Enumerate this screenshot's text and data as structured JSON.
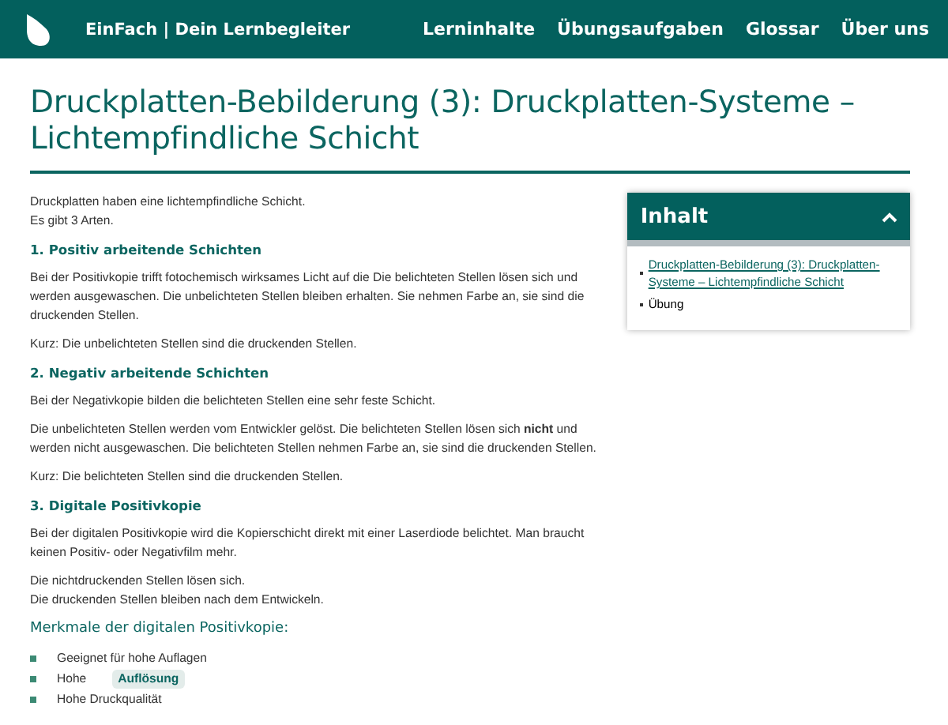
{
  "header": {
    "site_name": "EinFach | Dein Lernbegleiter",
    "nav": [
      {
        "label": "Lerninhalte"
      },
      {
        "label": "Übungsaufgaben"
      },
      {
        "label": "Glossar"
      },
      {
        "label": "Über uns"
      }
    ]
  },
  "title": "Druckplatten-Bebilderung (3): Druckplatten-Systeme – Lichtempfindliche Schicht",
  "content": [
    {
      "kind": "paragraph",
      "lines": [
        "Druckplatten haben eine lichtempfindliche Schicht.",
        "Es gibt 3 Arten."
      ]
    },
    {
      "kind": "heading",
      "text": "1. Positiv arbeitende Schichten"
    },
    {
      "kind": "paragraph",
      "lines": [
        "Bei der Positivkopie trifft fotochemisch wirksames Licht auf die Die belichteten Stellen lösen sich und werden ausgewaschen. Die unbelichteten Stellen bleiben erhalten. Sie nehmen Farbe an, sie sind die druckenden Stellen."
      ]
    },
    {
      "kind": "paragraph",
      "lines": [
        "Kurz: Die unbelichteten Stellen sind die druckenden Stellen."
      ]
    },
    {
      "kind": "heading",
      "text": "2. Negativ arbeitende Schichten"
    },
    {
      "kind": "paragraph",
      "lines": [
        "Bei der Negativkopie bilden die belichteten Stellen eine sehr feste Schicht."
      ]
    },
    {
      "kind": "paragraph",
      "lines": [
        "Die unbelichteten Stellen werden vom Entwickler gelöst. Die belichteten Stellen lösen sich **nicht** und werden nicht ausgewaschen. Die belichteten Stellen nehmen Farbe an, sie sind die druckenden Stellen."
      ]
    },
    {
      "kind": "paragraph",
      "lines": [
        "Kurz: Die belichteten Stellen sind die druckenden Stellen."
      ]
    },
    {
      "kind": "heading",
      "text": "3. Digitale Positivkopie"
    },
    {
      "kind": "paragraph",
      "lines": [
        "Bei der digitalen Positivkopie wird die Kopierschicht direkt mit einer Laserdiode belichtet. Man braucht keinen Positiv- oder Negativfilm mehr."
      ]
    },
    {
      "kind": "paragraph",
      "lines": [
        "Die nichtdruckenden Stellen lösen sich.",
        "Die druckenden Stellen bleiben nach dem Entwickeln."
      ]
    },
    {
      "kind": "subheading",
      "text": "Merkmale der digitalen Positivkopie:"
    },
    {
      "kind": "list",
      "items": [
        {
          "text": "Geeignet für hohe Auflagen"
        },
        {
          "text": "Hohe",
          "term": "Auflösung"
        },
        {
          "text": "Hohe Druckqualität"
        }
      ]
    }
  ],
  "toc": {
    "title": "Inhalt",
    "expanded": true,
    "items": [
      {
        "kind": "link",
        "label": "Druckplatten-Bebilderung (3): Druckplatten-Systeme – Lichtempfindliche Schicht"
      },
      {
        "kind": "text",
        "label": "Übung"
      }
    ]
  }
}
